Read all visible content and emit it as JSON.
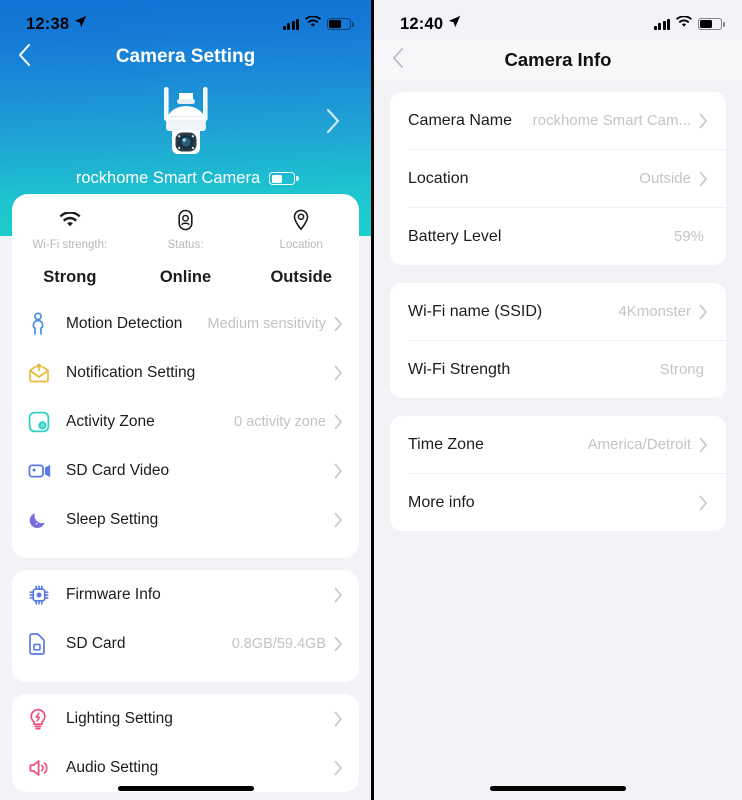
{
  "left": {
    "status_bar": {
      "time": "12:38",
      "location_icon": "location-arrow-icon",
      "signal_icon": "cellular-signal-icon",
      "wifi_icon": "wifi-icon",
      "battery_icon": "battery-icon"
    },
    "nav": {
      "back_icon": "chevron-left-icon",
      "title": "Camera Setting"
    },
    "hero": {
      "device_image": "ptz-dome-camera-image",
      "next_icon": "chevron-right-icon",
      "device_name": "rockhome Smart Camera",
      "device_battery_icon": "battery-icon"
    },
    "status_strip": [
      {
        "icon": "wifi-icon",
        "label": "Wi-Fi strength:",
        "value": "Strong"
      },
      {
        "icon": "status-dot-icon",
        "label": "Status:",
        "value": "Online"
      },
      {
        "icon": "location-pin-icon",
        "label": "Location",
        "value": "Outside"
      }
    ],
    "group1": [
      {
        "icon": "person-motion-icon",
        "label": "Motion Detection",
        "value": "Medium sensitivity",
        "chevron": true
      },
      {
        "icon": "envelope-up-icon",
        "label": "Notification Setting",
        "value": "",
        "chevron": true
      },
      {
        "icon": "activity-zone-icon",
        "label": "Activity Zone",
        "value": "0 activity zone",
        "chevron": true
      },
      {
        "icon": "video-camera-icon",
        "label": "SD Card Video",
        "value": "",
        "chevron": true
      },
      {
        "icon": "moon-icon",
        "label": "Sleep Setting",
        "value": "",
        "chevron": true
      }
    ],
    "group2": [
      {
        "icon": "chip-icon",
        "label": "Firmware Info",
        "value": "",
        "chevron": true
      },
      {
        "icon": "sd-card-icon",
        "label": "SD Card",
        "value": "0.8GB/59.4GB",
        "chevron": true
      }
    ],
    "group3": [
      {
        "icon": "lightbulb-icon",
        "label": "Lighting Setting",
        "value": "",
        "chevron": true
      },
      {
        "icon": "speaker-icon",
        "label": "Audio Setting",
        "value": "",
        "chevron": true
      }
    ]
  },
  "right": {
    "status_bar": {
      "time": "12:40",
      "location_icon": "location-arrow-icon",
      "signal_icon": "cellular-signal-icon",
      "wifi_icon": "wifi-icon",
      "battery_icon": "battery-icon"
    },
    "nav": {
      "back_icon": "chevron-left-icon",
      "title": "Camera Info"
    },
    "groups": [
      {
        "rows": [
          {
            "key": "Camera Name",
            "value": "rockhome Smart Cam...",
            "chevron": true
          },
          {
            "key": "Location",
            "value": "Outside",
            "chevron": true
          },
          {
            "key": "Battery Level",
            "value": "59%",
            "chevron": false
          }
        ]
      },
      {
        "rows": [
          {
            "key": "Wi-Fi name (SSID)",
            "value": "4Kmonster",
            "chevron": true
          },
          {
            "key": "Wi-Fi Strength",
            "value": "Strong",
            "chevron": false
          }
        ]
      },
      {
        "rows": [
          {
            "key": "Time Zone",
            "value": "America/Detroit",
            "chevron": true
          },
          {
            "key": "More info",
            "value": "",
            "chevron": true
          }
        ]
      }
    ]
  },
  "colors": {
    "hero_top": "#1173d4",
    "hero_bottom": "#1ccfcb",
    "icon_blue": "#5b79e8",
    "icon_teal": "#2ed3c6",
    "icon_yellow": "#e8b93c",
    "icon_pink": "#ee4d7a",
    "icon_purple": "#7a6ce0",
    "value_gray": "#c2c2c7",
    "card_white": "#ffffff",
    "page_bg": "#f2f2f7"
  }
}
